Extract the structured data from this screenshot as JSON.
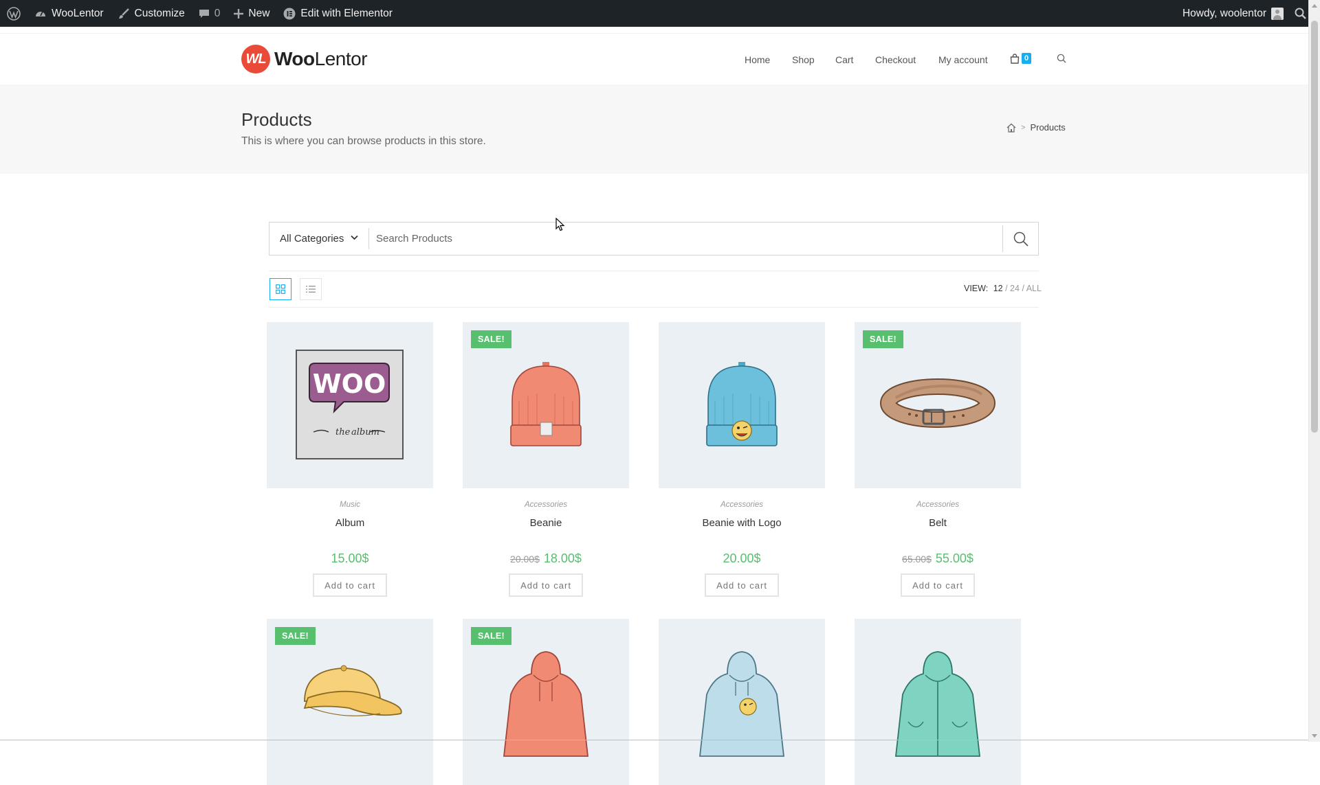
{
  "adminbar": {
    "site": "WooLentor",
    "customize": "Customize",
    "comments": "0",
    "new": "New",
    "elementor": "Edit with Elementor",
    "howdy": "Howdy, woolentor"
  },
  "header": {
    "logo_mark": "WL",
    "logo_bold": "Woo",
    "logo_rest": "Lentor",
    "nav": [
      "Home",
      "Shop",
      "Cart",
      "Checkout",
      "My account"
    ],
    "cart_count": "0"
  },
  "page_header": {
    "title": "Products",
    "subtitle": "This is where you can browse products in this store.",
    "breadcrumb_current": "Products",
    "breadcrumb_sep": ">"
  },
  "search": {
    "category": "All Categories",
    "placeholder": "Search Products"
  },
  "toolbar": {
    "view_label": "VIEW:",
    "view_current": "12",
    "view_24": "24",
    "view_all": "ALL",
    "sep": "/"
  },
  "products": [
    {
      "category": "Music",
      "title": "Album",
      "price": "15.00$",
      "old_price": "",
      "sale": "",
      "button": "Add to cart",
      "icon": "album-icon"
    },
    {
      "category": "Accessories",
      "title": "Beanie",
      "price": "18.00$",
      "old_price": "20.00$",
      "sale": "SALE!",
      "button": "Add to cart",
      "icon": "beanie-icon"
    },
    {
      "category": "Accessories",
      "title": "Beanie with Logo",
      "price": "20.00$",
      "old_price": "",
      "sale": "",
      "button": "Add to cart",
      "icon": "beanie-logo-icon"
    },
    {
      "category": "Accessories",
      "title": "Belt",
      "price": "55.00$",
      "old_price": "65.00$",
      "sale": "SALE!",
      "button": "Add to cart",
      "icon": "belt-icon"
    },
    {
      "sale": "SALE!",
      "icon": "cap-icon"
    },
    {
      "sale": "SALE!",
      "icon": "hoodie-icon"
    },
    {
      "sale": "",
      "icon": "hoodie-logo-icon"
    },
    {
      "sale": "",
      "icon": "hoodie-zipper-icon"
    }
  ],
  "colors": {
    "accent": "#13aff0",
    "sale": "#57bf6d",
    "adminbar": "#1d2327"
  }
}
